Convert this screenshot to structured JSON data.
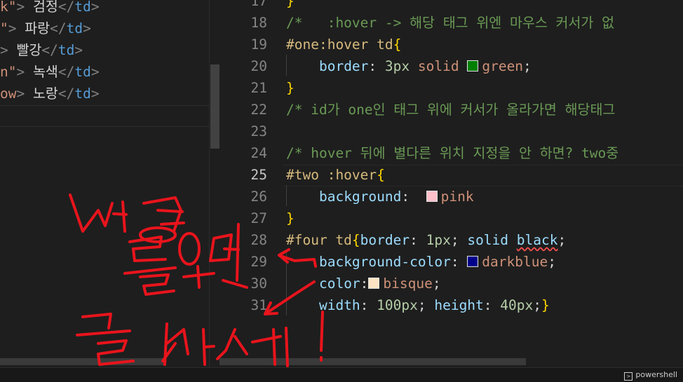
{
  "left_editor": {
    "lines": [
      {
        "str_tail": "k\"",
        "close": "> ",
        "text": "검정",
        "end_tag": "td"
      },
      {
        "str_tail": "\"",
        "close": "> ",
        "text": "파랑",
        "end_tag": "td"
      },
      {
        "str_tail": "",
        "close": "> ",
        "text": "빨강",
        "end_tag": "td"
      },
      {
        "str_tail": "n\"",
        "close": "> ",
        "text": "녹색",
        "end_tag": "td"
      },
      {
        "str_tail": "ow",
        "close": "> ",
        "text": "노랑",
        "end_tag": "td"
      }
    ]
  },
  "right_editor": {
    "active_line": "25",
    "lines": [
      {
        "num": "17",
        "parts": [
          {
            "t": "}",
            "c": "c-brace"
          }
        ]
      },
      {
        "num": "18",
        "parts": [
          {
            "t": "/*   :hover -> 해당 태그 위엔 마우스 커서가 없",
            "c": "c-com"
          }
        ]
      },
      {
        "num": "19",
        "parts": [
          {
            "t": "#one:hover td",
            "c": "c-sel"
          },
          {
            "t": "{",
            "c": "c-brace"
          }
        ]
      },
      {
        "num": "20",
        "parts": [
          {
            "t": "    "
          },
          {
            "t": "border",
            "c": "c-prop"
          },
          {
            "t": ": "
          },
          {
            "t": "3px",
            "c": "c-num"
          },
          {
            "t": " "
          },
          {
            "t": "solid",
            "c": "c-val"
          },
          {
            "t": " "
          },
          {
            "sw": "#008000"
          },
          {
            "t": "green",
            "c": "c-val"
          },
          {
            "t": ";"
          }
        ]
      },
      {
        "num": "21",
        "parts": [
          {
            "t": "}",
            "c": "c-brace"
          }
        ]
      },
      {
        "num": "22",
        "parts": [
          {
            "t": "/* id가 one인 태그 위에 커서가 올라가면 해당태그",
            "c": "c-com"
          }
        ]
      },
      {
        "num": "23",
        "parts": []
      },
      {
        "num": "24",
        "parts": [
          {
            "t": "/* hover 뒤에 별다른 위치 지정을 안 하면? two중",
            "c": "c-com"
          }
        ]
      },
      {
        "num": "25",
        "parts": [
          {
            "t": "#two :hover",
            "c": "c-sel"
          },
          {
            "t": "{",
            "c": "c-brace"
          }
        ]
      },
      {
        "num": "26",
        "parts": [
          {
            "t": "    "
          },
          {
            "t": "background",
            "c": "c-prop"
          },
          {
            "t": ":  "
          },
          {
            "sw": "#ffc0cb"
          },
          {
            "t": "pink",
            "c": "c-val"
          }
        ]
      },
      {
        "num": "27",
        "parts": [
          {
            "t": "}",
            "c": "c-brace"
          }
        ]
      },
      {
        "num": "28",
        "parts": [
          {
            "t": "#four td",
            "c": "c-sel"
          },
          {
            "t": "{",
            "c": "c-brace"
          },
          {
            "t": "border",
            "c": "c-prop"
          },
          {
            "t": ": "
          },
          {
            "t": "1px",
            "c": "c-num"
          },
          {
            "t": "; "
          },
          {
            "t": "solid",
            "c": "c-prop"
          },
          {
            "t": " "
          },
          {
            "t": "black",
            "c": "c-prop squiggle"
          },
          {
            "t": ";"
          }
        ]
      },
      {
        "num": "29",
        "parts": [
          {
            "t": "    "
          },
          {
            "t": "background-color",
            "c": "c-prop"
          },
          {
            "t": ": "
          },
          {
            "sw": "#00008b"
          },
          {
            "t": "darkblue",
            "c": "c-val"
          },
          {
            "t": ";"
          }
        ]
      },
      {
        "num": "30",
        "parts": [
          {
            "t": "    "
          },
          {
            "t": "color",
            "c": "c-prop"
          },
          {
            "t": ":"
          },
          {
            "sw": "#ffe4c4"
          },
          {
            "t": "bisque",
            "c": "c-val"
          },
          {
            "t": ";"
          }
        ]
      },
      {
        "num": "31",
        "parts": [
          {
            "t": "    "
          },
          {
            "t": "width",
            "c": "c-prop"
          },
          {
            "t": ": "
          },
          {
            "t": "100px",
            "c": "c-num"
          },
          {
            "t": "; "
          },
          {
            "t": "height",
            "c": "c-prop"
          },
          {
            "t": ": "
          },
          {
            "t": "40px",
            "c": "c-num"
          },
          {
            "t": ";"
          },
          {
            "t": "}",
            "c": "c-brace"
          }
        ]
      }
    ]
  },
  "status_bar": {
    "terminal_label": "powershell"
  },
  "annotation_ink_color": "#e8141c"
}
